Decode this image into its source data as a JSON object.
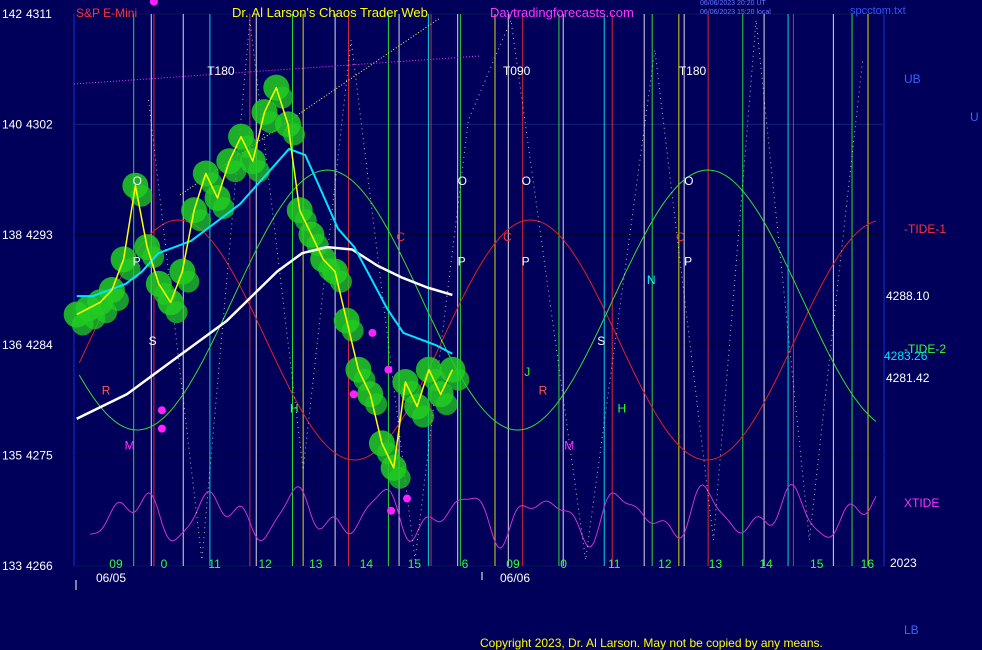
{
  "header": {
    "symbol": "S&P E-Mini",
    "title": "Dr. Al Larson's Chaos Trader Web",
    "site": "Daytradingforecasts.com",
    "stamp1": "06/06/2023 20:20 UT",
    "stamp2": "06/06/2023 15:20 local",
    "file": "spcctom.txt"
  },
  "copyright": "Copyright 2023, Dr. Al Larson. May not be copied by any means.",
  "right_labels": {
    "ub": "UB",
    "u": "U",
    "lb": "LB",
    "tide1": "-TIDE-1",
    "tide2": "-TIDE-2",
    "xtide": "XTIDE",
    "year": "2023",
    "price_a": "4288.10",
    "price_b": "4283.26",
    "price_c": "4281.42"
  },
  "colors": {
    "background": "#00005a",
    "price": "#ffff00",
    "cyan_ma": "#00e5ff",
    "white_ma": "#ffffff",
    "green_tide": "#33dd33",
    "red_tide": "#dd2222",
    "magenta_xtide": "#cc33cc",
    "bubble": "#22cc22",
    "dots": "#ff22ff"
  },
  "markers": [
    {
      "t": 1.1,
      "text": "O",
      "color": "#ffffff"
    },
    {
      "t": 1.1,
      "text": "P",
      "color": "#ffffff",
      "y": 137.9
    },
    {
      "t": 1.4,
      "text": "S",
      "color": "#ffffff",
      "y": 136.6
    },
    {
      "t": 0.52,
      "text": "R",
      "color": "#ff5555",
      "y": 135.8
    },
    {
      "t": 0.95,
      "text": "M",
      "color": "#ff33ff",
      "y": 134.9
    },
    {
      "t": 4.05,
      "text": "H",
      "color": "#33ff33",
      "y": 135.5
    },
    {
      "t": 6.05,
      "text": "C",
      "color": "#ff3333",
      "y": 138.3
    },
    {
      "t": 7.2,
      "text": "O",
      "color": "#ffffff"
    },
    {
      "t": 7.2,
      "text": "P",
      "color": "#ffffff",
      "y": 137.9
    },
    {
      "t": 8.05,
      "text": "C",
      "color": "#ff3333",
      "y": 138.3
    },
    {
      "t": 8.4,
      "text": "O",
      "color": "#ffffff"
    },
    {
      "t": 8.4,
      "text": "P",
      "color": "#ffffff",
      "y": 137.9
    },
    {
      "t": 8.45,
      "text": "J",
      "color": "#33ff33",
      "y": 136.1
    },
    {
      "t": 8.72,
      "text": "R",
      "color": "#ff5555",
      "y": 135.8
    },
    {
      "t": 9.2,
      "text": "M",
      "color": "#ff33ff",
      "y": 134.9
    },
    {
      "t": 9.82,
      "text": "S",
      "color": "#ffffff",
      "y": 136.6
    },
    {
      "t": 10.2,
      "text": "H",
      "color": "#33ff33",
      "y": 135.5
    },
    {
      "t": 10.75,
      "text": "N",
      "color": "#00ffff",
      "y": 137.6
    },
    {
      "t": 11.3,
      "text": "C",
      "color": "#ff3333",
      "y": 138.3
    },
    {
      "t": 11.45,
      "text": "O",
      "color": "#ffffff"
    },
    {
      "t": 11.45,
      "text": "P",
      "color": "#ffffff",
      "y": 137.9
    }
  ],
  "t_marks": [
    {
      "t": 2.5,
      "text": "T180"
    },
    {
      "t": 8.05,
      "text": "T090"
    },
    {
      "t": 11.35,
      "text": "T180"
    }
  ],
  "chart_data": {
    "type": "line",
    "title": "S&P E-Mini",
    "x_ticks": [
      "09",
      "0",
      "11",
      "12",
      "13",
      "14",
      "15",
      "6",
      "09",
      "0",
      "11",
      "12",
      "13",
      "14",
      "15",
      "16"
    ],
    "x_tick_positions": [
      0.6,
      1.5,
      2.45,
      3.4,
      4.35,
      5.3,
      6.2,
      7.15,
      8.05,
      9.0,
      9.95,
      10.9,
      11.85,
      12.8,
      13.75,
      14.7
    ],
    "dates": [
      "06/05",
      "06/06"
    ],
    "y_ticks_left": [
      142,
      140,
      138,
      136,
      135,
      133
    ],
    "y_ticks_price": [
      4311,
      4302,
      4293,
      4284,
      4275,
      4266
    ],
    "ylim_left": [
      133,
      142
    ],
    "ylim_price": [
      4266,
      4311
    ],
    "series": [
      {
        "name": "price",
        "values": [
          4286.5,
          4287.0,
          4287.5,
          4288.5,
          4291,
          4297,
          4292,
          4289,
          4287.5,
          4290,
          4295,
          4298,
          4296,
          4299,
          4301,
          4299,
          4303,
          4305,
          4302,
          4295,
          4293,
          4291,
          4290,
          4286,
          4282,
          4280,
          4276,
          4274,
          4281,
          4279,
          4282,
          4280,
          4282
        ]
      },
      {
        "name": "cyan_ma",
        "values": [
          4288,
          4288,
          4288.5,
          4289,
          4290,
          4291.5,
          4292,
          4292.5,
          4293.5,
          4294.5,
          4295.5,
          4297,
          4298.5,
          4300,
          4299.5,
          4296.5,
          4293.5,
          4292,
          4289.5,
          4287,
          4285,
          4284.5,
          4284,
          4283.3
        ]
      },
      {
        "name": "white_ma",
        "values": [
          4278,
          4279,
          4280,
          4281.5,
          4283,
          4284.5,
          4286,
          4288,
          4290,
          4291.5,
          4292,
          4291.8,
          4290.5,
          4289.5,
          4288.7,
          4288.1
        ]
      }
    ],
    "grid": true
  }
}
